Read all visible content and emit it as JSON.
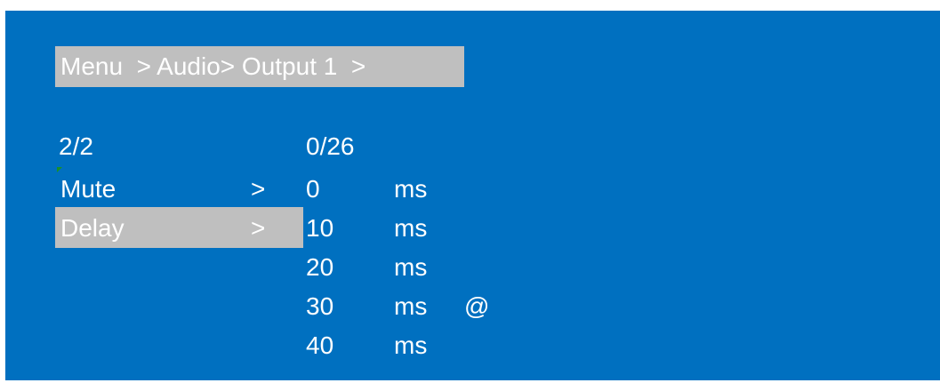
{
  "breadcrumb": {
    "text": "Menu  > Audio> Output 1  >"
  },
  "left_column": {
    "page_indicator": "2/2",
    "items": [
      {
        "label": "Mute",
        "arrow": ">",
        "selected": false
      },
      {
        "label": "Delay",
        "arrow": ">",
        "selected": true
      }
    ]
  },
  "right_column": {
    "index_indicator": "0/26",
    "options": [
      {
        "value": "0",
        "unit": "ms",
        "mark": ""
      },
      {
        "value": "10",
        "unit": "ms",
        "mark": ""
      },
      {
        "value": "20",
        "unit": "ms",
        "mark": ""
      },
      {
        "value": "30",
        "unit": "ms",
        "mark": "@"
      },
      {
        "value": "40",
        "unit": "ms",
        "mark": ""
      }
    ]
  },
  "colors": {
    "background": "#0070c0",
    "highlight": "#bfbfbf",
    "text": "#ffffff"
  }
}
